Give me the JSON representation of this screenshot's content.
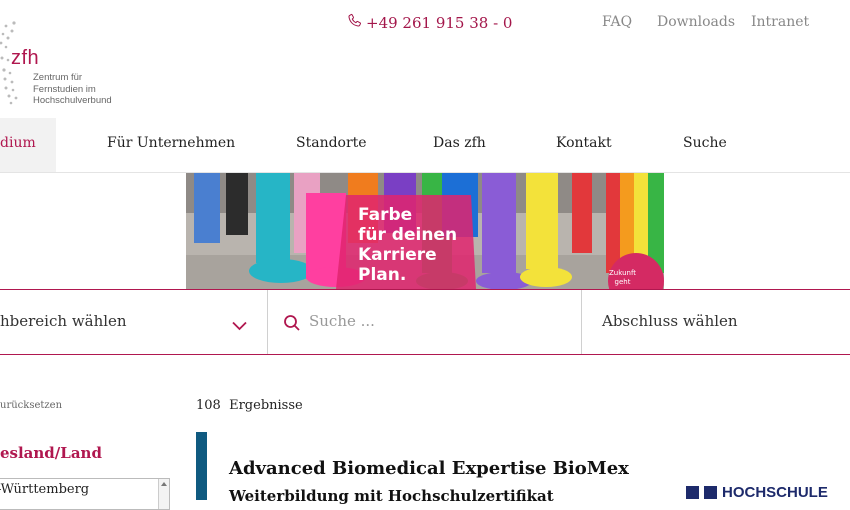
{
  "header": {
    "logo_name": "zfh",
    "logo_subtitle": [
      "Zentrum für",
      "Fernstudien im",
      "Hochschulverbund"
    ],
    "phone": "+49 261 915 38 - 0",
    "top_links": [
      "FAQ",
      "Downloads",
      "Intranet"
    ]
  },
  "nav": {
    "active": "dium",
    "items": [
      "Für Unternehmen",
      "Standorte",
      "Das zfh",
      "Kontakt",
      "Suche"
    ]
  },
  "banner": {
    "lines": [
      "Farbe",
      "für deinen",
      "Karriere",
      "Plan."
    ],
    "badge": [
      "Zukunft",
      "geht"
    ]
  },
  "filters": {
    "field": "hbereich wählen",
    "search_placeholder": "Suche ...",
    "degree": "Abschluss wählen"
  },
  "sidebar": {
    "reset_label": "urücksetzen",
    "section_title": "esland/Land",
    "list_item": "-Württemberg"
  },
  "results": {
    "count": "108",
    "count_label": "Ergebnisse",
    "card": {
      "title": "Advanced Biomedical Expertise BioMex",
      "subtitle": "Weiterbildung mit Hochschulzertifikat",
      "university": "HOCHSCHULE"
    }
  },
  "colors": {
    "accent": "#b0174f",
    "card_bar": "#0f5a80",
    "university_logo": "#1d2a6b"
  },
  "icons": [
    "phone-icon",
    "chevron-down-icon",
    "search-icon",
    "logo-dots-icon"
  ]
}
